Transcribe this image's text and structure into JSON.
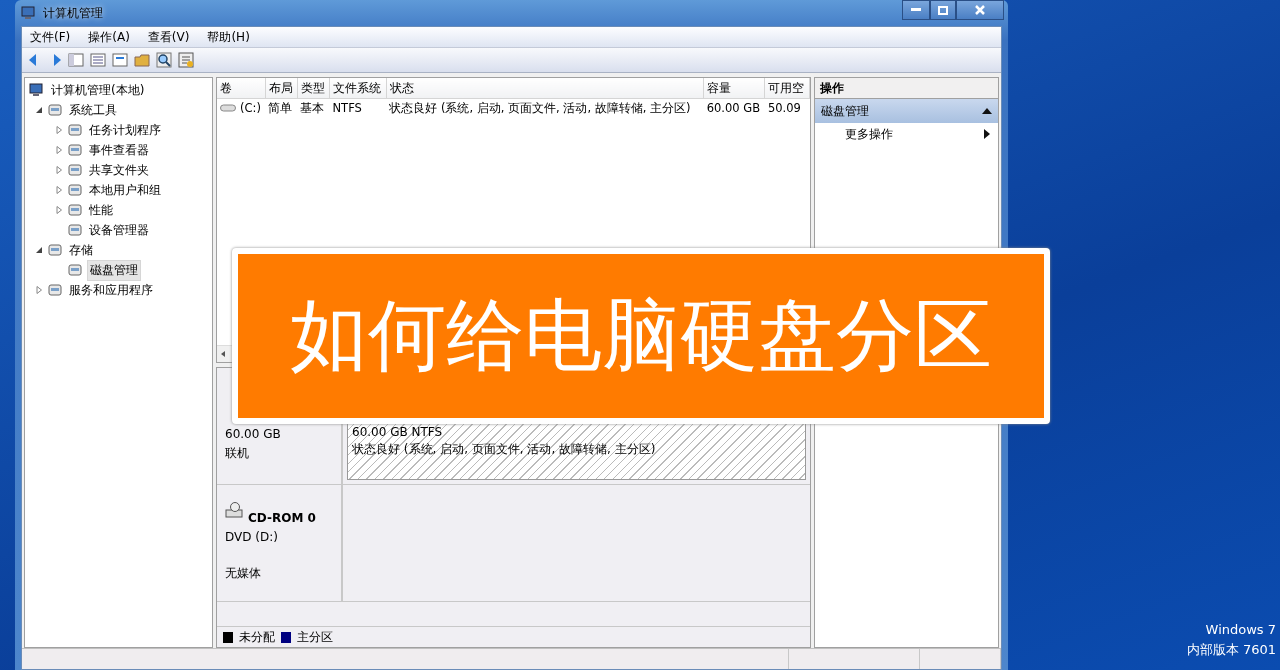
{
  "window": {
    "title": "计算机管理"
  },
  "menu": [
    "文件(F)",
    "操作(A)",
    "查看(V)",
    "帮助(H)"
  ],
  "tree": {
    "label": "计算机管理(本地)",
    "children": [
      {
        "label": "系统工具",
        "expanded": true,
        "selected": false,
        "children": [
          {
            "label": "任务计划程序",
            "expanded": false,
            "selected": false
          },
          {
            "label": "事件查看器",
            "expanded": false,
            "selected": false
          },
          {
            "label": "共享文件夹",
            "expanded": false,
            "selected": false
          },
          {
            "label": "本地用户和组",
            "expanded": false,
            "selected": false
          },
          {
            "label": "性能",
            "expanded": false,
            "selected": false
          },
          {
            "label": "设备管理器",
            "selected": false
          }
        ]
      },
      {
        "label": "存储",
        "expanded": true,
        "selected": false,
        "children": [
          {
            "label": "磁盘管理",
            "selected": true
          }
        ]
      },
      {
        "label": "服务和应用程序",
        "expanded": false,
        "selected": false
      }
    ]
  },
  "table": {
    "columns": [
      "卷",
      "布局",
      "类型",
      "文件系统",
      "状态",
      "容量",
      "可用空"
    ],
    "rows": [
      [
        "(C:)",
        "简单",
        "基本",
        "NTFS",
        "状态良好 (系统, 启动, 页面文件, 活动, 故障转储, 主分区)",
        "60.00 GB",
        "50.09"
      ]
    ]
  },
  "disks": [
    {
      "kind": "hdd",
      "lines": [
        "60.00 GB",
        "联机"
      ],
      "partition": [
        "60.00 GB NTFS",
        "状态良好 (系统, 启动, 页面文件, 活动, 故障转储, 主分区)"
      ]
    },
    {
      "kind": "cdrom",
      "name": "CD-ROM 0",
      "lines": [
        "DVD (D:)",
        "无媒体"
      ]
    }
  ],
  "legend": [
    {
      "label": "未分配",
      "color": "#000000"
    },
    {
      "label": "主分区",
      "color": "#000080"
    }
  ],
  "actions": {
    "title": "操作",
    "sections": [
      {
        "label": "磁盘管理",
        "expanded": true,
        "items": [
          "更多操作"
        ]
      }
    ]
  },
  "banner": "如何给电脑硬盘分区",
  "desktop_text": [
    "Windows 7",
    "内部版本 7601"
  ]
}
